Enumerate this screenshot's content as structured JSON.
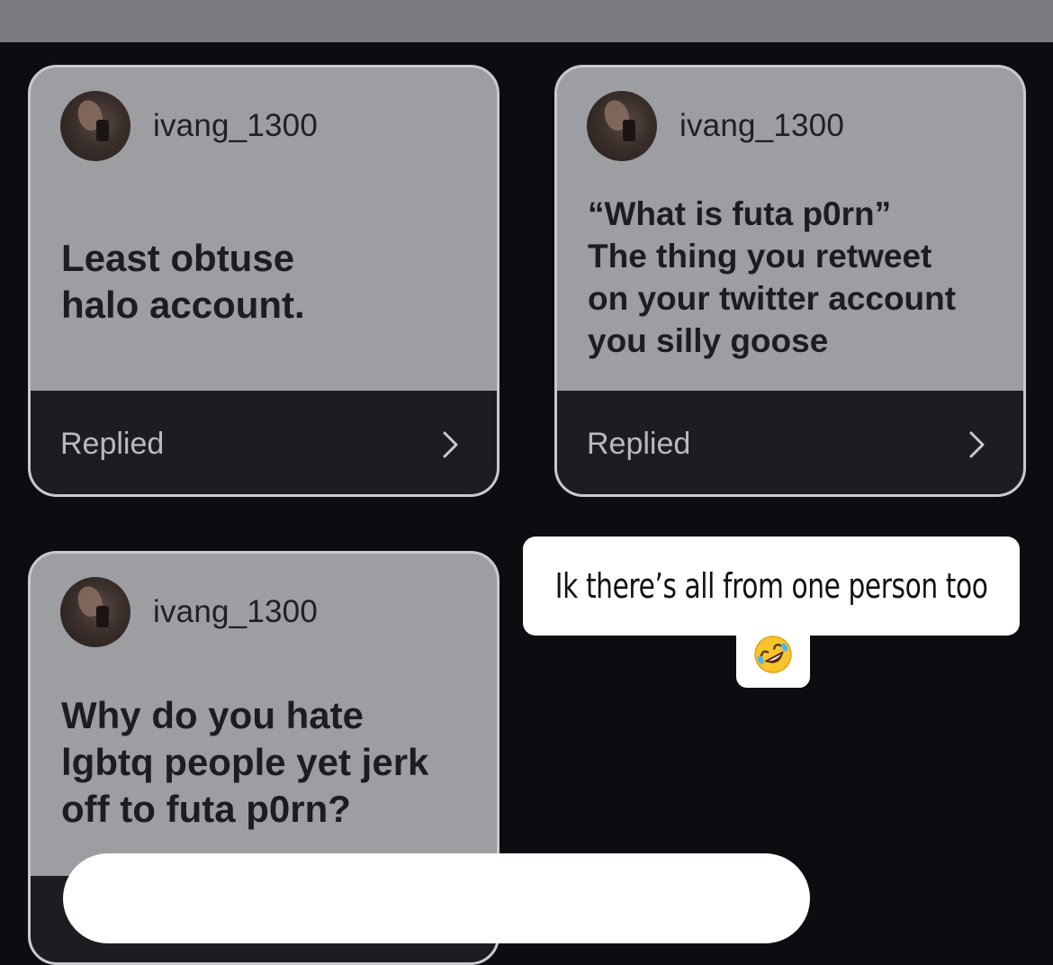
{
  "cards": [
    {
      "username": "ivang_1300",
      "message_lines": [
        "Least obtuse",
        "halo account."
      ],
      "status": "Replied",
      "icons": {
        "avatar": "profile-photo",
        "chevron": "chevron-right-icon"
      }
    },
    {
      "username": "ivang_1300",
      "message_lines": [
        "“What is futa p0rn”",
        "The thing you retweet",
        "on your twitter account",
        "you silly goose"
      ],
      "status": "Replied",
      "icons": {
        "avatar": "profile-photo",
        "chevron": "chevron-right-icon"
      }
    },
    {
      "username": "ivang_1300",
      "message_lines": [
        "Why do you hate",
        "lgbtq people yet jerk",
        "off to futa p0rn?"
      ],
      "status": "",
      "icons": {
        "avatar": "profile-photo"
      }
    }
  ],
  "sticker": {
    "text": "Ik there’s all from one person too",
    "emoji": "rolling-on-floor-laughing-emoji"
  },
  "colors": {
    "background": "#0c0d11",
    "card": "#9d9ea2",
    "card_footer": "#1c1d21",
    "sticker": "#ffffff"
  }
}
